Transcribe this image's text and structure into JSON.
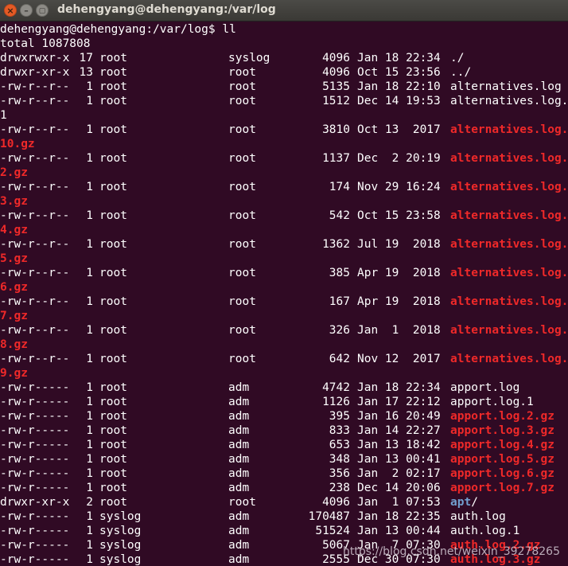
{
  "window": {
    "title": "dehengyang@dehengyang:/var/log",
    "close_glyph": "×",
    "minimize_glyph": "–",
    "maximize_glyph": "▢"
  },
  "terminal": {
    "prompt": "dehengyang@dehengyang:/var/log$ ll",
    "total": "total 1087808",
    "colors": {
      "background": "#300a24",
      "text": "#ffffff",
      "red": "#ef2929",
      "dir": "#729fcf"
    },
    "lines": [
      {
        "kind": "entry",
        "perm": "drwxrwxr-x",
        "links": "17",
        "owner": "root",
        "group": "syslog",
        "size": "4096",
        "date": "Jan 18 22:34",
        "name": "./",
        "style": "plain"
      },
      {
        "kind": "entry",
        "perm": "drwxr-xr-x",
        "links": "13",
        "owner": "root",
        "group": "root",
        "size": "4096",
        "date": "Oct 15 23:56",
        "name": "../",
        "style": "plain"
      },
      {
        "kind": "entry",
        "perm": "-rw-r--r--",
        "links": "1",
        "owner": "root",
        "group": "root",
        "size": "5135",
        "date": "Jan 18 22:10",
        "name": "alternatives.log",
        "style": "plain"
      },
      {
        "kind": "entry",
        "perm": "-rw-r--r--",
        "links": "1",
        "owner": "root",
        "group": "root",
        "size": "1512",
        "date": "Dec 14 19:53",
        "name": "alternatives.log.",
        "style": "plain"
      },
      {
        "kind": "wrap",
        "text": "1",
        "style": "plain"
      },
      {
        "kind": "entry",
        "perm": "-rw-r--r--",
        "links": "1",
        "owner": "root",
        "group": "root",
        "size": "3810",
        "date": "Oct 13  2017",
        "name": "alternatives.log.",
        "style": "red"
      },
      {
        "kind": "wrap",
        "text": "10.gz",
        "style": "red"
      },
      {
        "kind": "entry",
        "perm": "-rw-r--r--",
        "links": "1",
        "owner": "root",
        "group": "root",
        "size": "1137",
        "date": "Dec  2 20:19",
        "name": "alternatives.log.",
        "style": "red"
      },
      {
        "kind": "wrap",
        "text": "2.gz",
        "style": "red"
      },
      {
        "kind": "entry",
        "perm": "-rw-r--r--",
        "links": "1",
        "owner": "root",
        "group": "root",
        "size": "174",
        "date": "Nov 29 16:24",
        "name": "alternatives.log.",
        "style": "red"
      },
      {
        "kind": "wrap",
        "text": "3.gz",
        "style": "red"
      },
      {
        "kind": "entry",
        "perm": "-rw-r--r--",
        "links": "1",
        "owner": "root",
        "group": "root",
        "size": "542",
        "date": "Oct 15 23:58",
        "name": "alternatives.log.",
        "style": "red"
      },
      {
        "kind": "wrap",
        "text": "4.gz",
        "style": "red"
      },
      {
        "kind": "entry",
        "perm": "-rw-r--r--",
        "links": "1",
        "owner": "root",
        "group": "root",
        "size": "1362",
        "date": "Jul 19  2018",
        "name": "alternatives.log.",
        "style": "red"
      },
      {
        "kind": "wrap",
        "text": "5.gz",
        "style": "red"
      },
      {
        "kind": "entry",
        "perm": "-rw-r--r--",
        "links": "1",
        "owner": "root",
        "group": "root",
        "size": "385",
        "date": "Apr 19  2018",
        "name": "alternatives.log.",
        "style": "red"
      },
      {
        "kind": "wrap",
        "text": "6.gz",
        "style": "red"
      },
      {
        "kind": "entry",
        "perm": "-rw-r--r--",
        "links": "1",
        "owner": "root",
        "group": "root",
        "size": "167",
        "date": "Apr 19  2018",
        "name": "alternatives.log.",
        "style": "red"
      },
      {
        "kind": "wrap",
        "text": "7.gz",
        "style": "red"
      },
      {
        "kind": "entry",
        "perm": "-rw-r--r--",
        "links": "1",
        "owner": "root",
        "group": "root",
        "size": "326",
        "date": "Jan  1  2018",
        "name": "alternatives.log.",
        "style": "red"
      },
      {
        "kind": "wrap",
        "text": "8.gz",
        "style": "red"
      },
      {
        "kind": "entry",
        "perm": "-rw-r--r--",
        "links": "1",
        "owner": "root",
        "group": "root",
        "size": "642",
        "date": "Nov 12  2017",
        "name": "alternatives.log.",
        "style": "red"
      },
      {
        "kind": "wrap",
        "text": "9.gz",
        "style": "red"
      },
      {
        "kind": "entry",
        "perm": "-rw-r-----",
        "links": "1",
        "owner": "root",
        "group": "adm",
        "size": "4742",
        "date": "Jan 18 22:34",
        "name": "apport.log",
        "style": "plain"
      },
      {
        "kind": "entry",
        "perm": "-rw-r-----",
        "links": "1",
        "owner": "root",
        "group": "adm",
        "size": "1126",
        "date": "Jan 17 22:12",
        "name": "apport.log.1",
        "style": "plain"
      },
      {
        "kind": "entry",
        "perm": "-rw-r-----",
        "links": "1",
        "owner": "root",
        "group": "adm",
        "size": "395",
        "date": "Jan 16 20:49",
        "name": "apport.log.2.gz",
        "style": "red"
      },
      {
        "kind": "entry",
        "perm": "-rw-r-----",
        "links": "1",
        "owner": "root",
        "group": "adm",
        "size": "833",
        "date": "Jan 14 22:27",
        "name": "apport.log.3.gz",
        "style": "red"
      },
      {
        "kind": "entry",
        "perm": "-rw-r-----",
        "links": "1",
        "owner": "root",
        "group": "adm",
        "size": "653",
        "date": "Jan 13 18:42",
        "name": "apport.log.4.gz",
        "style": "red"
      },
      {
        "kind": "entry",
        "perm": "-rw-r-----",
        "links": "1",
        "owner": "root",
        "group": "adm",
        "size": "348",
        "date": "Jan 13 00:41",
        "name": "apport.log.5.gz",
        "style": "red"
      },
      {
        "kind": "entry",
        "perm": "-rw-r-----",
        "links": "1",
        "owner": "root",
        "group": "adm",
        "size": "356",
        "date": "Jan  2 02:17",
        "name": "apport.log.6.gz",
        "style": "red"
      },
      {
        "kind": "entry",
        "perm": "-rw-r-----",
        "links": "1",
        "owner": "root",
        "group": "adm",
        "size": "238",
        "date": "Dec 14 20:06",
        "name": "apport.log.7.gz",
        "style": "red"
      },
      {
        "kind": "entry",
        "perm": "drwxr-xr-x",
        "links": "2",
        "owner": "root",
        "group": "root",
        "size": "4096",
        "date": "Jan  1 07:53",
        "name": "apt",
        "suffix": "/",
        "style": "dir"
      },
      {
        "kind": "entry",
        "perm": "-rw-r-----",
        "links": "1",
        "owner": "syslog",
        "group": "adm",
        "size": "170487",
        "date": "Jan 18 22:35",
        "name": "auth.log",
        "style": "plain"
      },
      {
        "kind": "entry",
        "perm": "-rw-r-----",
        "links": "1",
        "owner": "syslog",
        "group": "adm",
        "size": "51524",
        "date": "Jan 13 00:44",
        "name": "auth.log.1",
        "style": "plain"
      },
      {
        "kind": "entry",
        "perm": "-rw-r-----",
        "links": "1",
        "owner": "syslog",
        "group": "adm",
        "size": "5067",
        "date": "Jan  7 07:30",
        "name": "auth.log.2.gz",
        "style": "red"
      },
      {
        "kind": "entry",
        "perm": "-rw-r-----",
        "links": "1",
        "owner": "syslog",
        "group": "adm",
        "size": "2555",
        "date": "Dec 30 07:30",
        "name": "auth.log.3.gz",
        "style": "red"
      }
    ]
  },
  "watermark": "https://blog.csdn.net/weixin_39278265"
}
